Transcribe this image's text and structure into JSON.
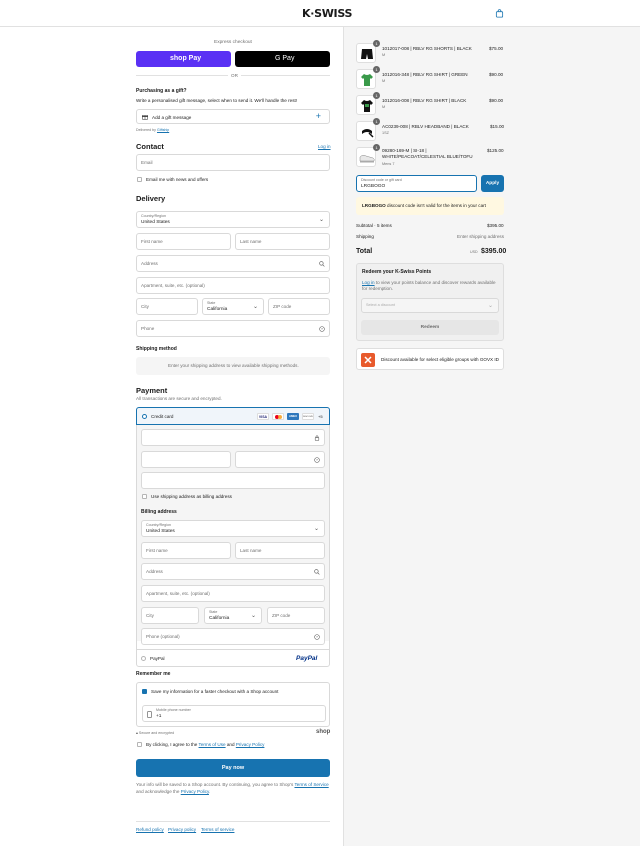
{
  "brand": {
    "logo": "K·SWISS"
  },
  "express": {
    "title": "Express checkout",
    "shop_pay": "shop Pay",
    "gpay": "G Pay",
    "or": "OR"
  },
  "gift": {
    "title": "Purchasing as a gift?",
    "desc": "Write a personalised gift message, select when to send it. We'll handle the rest!",
    "add_label": "Add a gift message",
    "delivered_by": "Delivered by",
    "delivered_link": "Giftship"
  },
  "contact": {
    "title": "Contact",
    "login": "Log in",
    "email_placeholder": "Email",
    "news_label": "Email me with news and offers"
  },
  "delivery": {
    "title": "Delivery",
    "country_label": "Country/Region",
    "country_value": "United States",
    "first_name": "First name",
    "last_name": "Last name",
    "address": "Address",
    "apartment": "Apartment, suite, etc. (optional)",
    "city": "City",
    "state_label": "State",
    "state_value": "California",
    "zip": "ZIP code",
    "phone": "Phone"
  },
  "shipping_method": {
    "title": "Shipping method",
    "info": "Enter your shipping address to view available shipping methods."
  },
  "payment": {
    "title": "Payment",
    "subtitle": "All transactions are secure and encrypted.",
    "credit_card": "Credit card",
    "cards": [
      "VISA",
      "MC",
      "AMEX",
      "DISCOVER"
    ],
    "more_cards": "+5",
    "use_shipping": "Use shipping address as billing address",
    "paypal": "PayPal",
    "paypal_logo": "PayPal"
  },
  "billing": {
    "title": "Billing address",
    "country_label": "Country/Region",
    "country_value": "United States",
    "first_name": "First name",
    "last_name": "Last name",
    "address": "Address",
    "apartment": "Apartment, suite, etc. (optional)",
    "city": "City",
    "state_label": "State",
    "state_value": "California",
    "zip": "ZIP code",
    "phone": "Phone (optional)"
  },
  "remember": {
    "title": "Remember me",
    "save_label": "Save my information for a faster checkout with a Shop account",
    "mobile_label": "Mobile phone number",
    "mobile_value": "+1",
    "secure": "Secure and encrypted",
    "shop_logo": "shop"
  },
  "terms": {
    "prefix": "By clicking, I agree to the",
    "tou": "Terms of Use",
    "and": "and",
    "privacy": "Privacy Policy"
  },
  "pay_now": "Pay now",
  "footer_note": {
    "line1": "Your info will be saved to a Shop account. By continuing, you agree to Shop's",
    "tos": "Terms of Service",
    "line2": "and acknowledge the",
    "privacy": "Privacy Policy",
    "end": "."
  },
  "footer_links": [
    "Refund policy",
    "Privacy policy",
    "Terms of service"
  ],
  "cart": {
    "items": [
      {
        "qty": "1",
        "name": "1012017-008 | RBLV RG SHORTS | BLACK",
        "variant": "M",
        "price": "$75.00"
      },
      {
        "qty": "1",
        "name": "1012016-348 | RBLV RG SHIRT | GREEN",
        "variant": "M",
        "price": "$90.00"
      },
      {
        "qty": "1",
        "name": "1012016-008 | RBLV RG SHIRT | BLACK",
        "variant": "M",
        "price": "$90.00"
      },
      {
        "qty": "1",
        "name": "AC0239-008 | RBLV HEADBAND | BLACK",
        "variant": "1SZ",
        "price": "$15.00"
      },
      {
        "qty": "1",
        "name": "09280-169-M | SI-18 | WHITE/PEACOAT/CELESTIAL BLUE/TOFU",
        "variant": "Mens 7",
        "price": "$125.00"
      }
    ],
    "discount_label": "Discount code or gift card",
    "discount_value": "LRGBOGO",
    "apply": "Apply",
    "error_code": "LRGBOGO",
    "error_msg": "discount code isn't valid for the items in your cart",
    "subtotal_label": "Subtotal · 5 items",
    "subtotal_value": "$395.00",
    "shipping_label": "Shipping",
    "shipping_value": "Enter shipping address",
    "total_label": "Total",
    "currency": "USD",
    "total_value": "$395.00"
  },
  "rewards": {
    "title": "Redeem your K-Swiss Points",
    "login": "Log in",
    "desc": "to view your points balance and discover rewards available for redemption.",
    "select_placeholder": "Select a discount",
    "redeem": "Redeem"
  },
  "govx": {
    "text": "Discount available for select eligible groups with GOVX ID"
  },
  "colors": {
    "accent": "#1773b0",
    "shop_purple": "#5a31f4",
    "error_bg": "#fff8e1"
  }
}
